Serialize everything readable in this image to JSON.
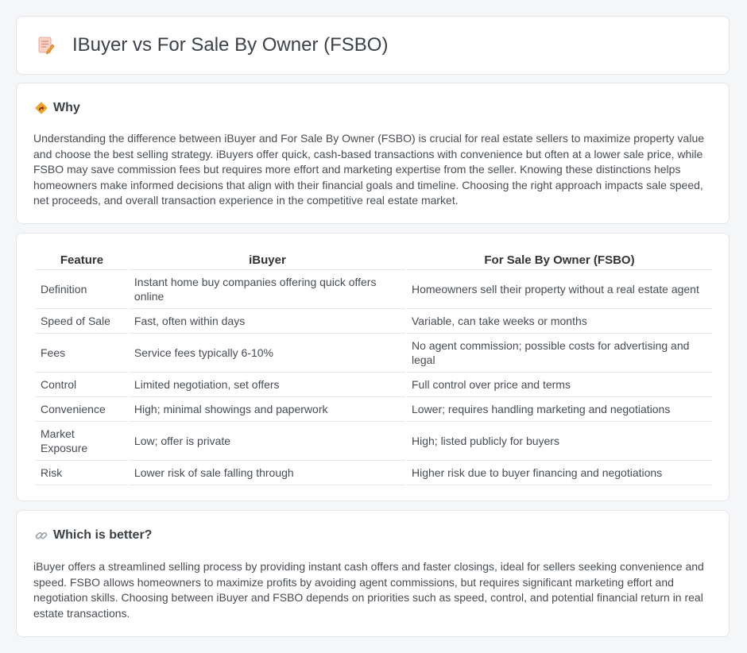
{
  "page": {
    "title": "IBuyer vs For Sale By Owner (FSBO)",
    "title_icon": "document-pen-icon"
  },
  "why": {
    "heading": "Why",
    "icon": "diamond-signpost-icon",
    "body": "Understanding the difference between iBuyer and For Sale By Owner (FSBO) is crucial for real estate sellers to maximize property value and choose the best selling strategy. iBuyers offer quick, cash-based transactions with convenience but often at a lower sale price, while FSBO may save commission fees but requires more effort and marketing expertise from the seller. Knowing these distinctions helps homeowners make informed decisions that align with their financial goals and timeline. Choosing the right approach impacts sale speed, net proceeds, and overall transaction experience in the competitive real estate market."
  },
  "table": {
    "headers": [
      "Feature",
      "iBuyer",
      "For Sale By Owner (FSBO)"
    ],
    "rows": [
      [
        "Definition",
        "Instant home buy companies offering quick offers online",
        "Homeowners sell their property without a real estate agent"
      ],
      [
        "Speed of Sale",
        "Fast, often within days",
        "Variable, can take weeks or months"
      ],
      [
        "Fees",
        "Service fees typically 6-10%",
        "No agent commission; possible costs for advertising and legal"
      ],
      [
        "Control",
        "Limited negotiation, set offers",
        "Full control over price and terms"
      ],
      [
        "Convenience",
        "High; minimal showings and paperwork",
        "Lower; requires handling marketing and negotiations"
      ],
      [
        "Market Exposure",
        "Low; offer is private",
        "High; listed publicly for buyers"
      ],
      [
        "Risk",
        "Lower risk of sale falling through",
        "Higher risk due to buyer financing and negotiations"
      ]
    ]
  },
  "better": {
    "heading": "Which is better?",
    "icon": "link-icon",
    "body": "iBuyer offers a streamlined selling process by providing instant cash offers and faster closings, ideal for sellers seeking convenience and speed. FSBO allows homeowners to maximize profits by avoiding agent commissions, but requires significant marketing effort and negotiation skills. Choosing between iBuyer and FSBO depends on priorities such as speed, control, and potential financial return in real estate transactions."
  },
  "colors": {
    "background": "#f5f6f8",
    "card": "#ffffff",
    "border": "#e2e5e9",
    "icon_accent": "#f0a030"
  }
}
